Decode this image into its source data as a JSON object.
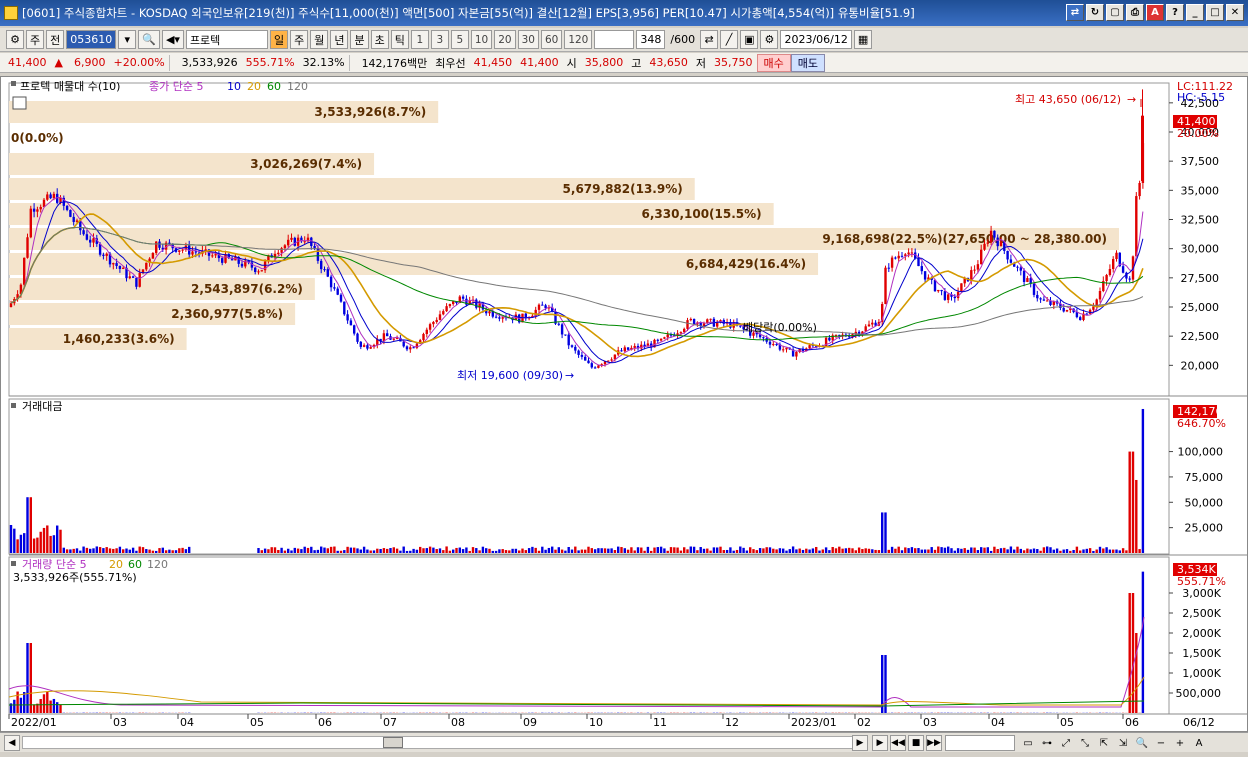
{
  "window": {
    "title": "[0601] 주식종합차트 - KOSDAQ 외국인보유[219(천)] 주식수[11,000(천)] 액면[500] 자본금[55(억)] 결산[12월] EPS[3,956] PER[10.47] 시가총액[4,554(억)] 유통비율[51.9]"
  },
  "toolbar": {
    "market": "주",
    "prev": "전",
    "code": "053610",
    "name": "프로텍",
    "periods": [
      "일",
      "주",
      "월",
      "년",
      "분",
      "초",
      "틱"
    ],
    "active_period": "일",
    "intervals": [
      "1",
      "3",
      "5",
      "10",
      "20",
      "30",
      "60",
      "120"
    ],
    "count": "348",
    "count_total": "/600",
    "date": "2023/06/12"
  },
  "quote": {
    "price": "41,400",
    "arrow": "▲",
    "change": "6,900",
    "change_pct": "+20.00%",
    "volume": "3,533,926",
    "volume_pct": "555.71%",
    "turnover": "32.13%",
    "amount": "142,176백만",
    "best_label": "최우선",
    "best_ask": "41,450",
    "best_bid": "41,400",
    "open_label": "시",
    "open": "35,800",
    "high_label": "고",
    "high": "43,650",
    "low_label": "저",
    "low": "35,750",
    "buy": "매수",
    "sell": "매도"
  },
  "price_panel": {
    "legend_profile": "프로텍 매물대 수(10)",
    "legend_ma": "종가 단순 5",
    "ma_periods": [
      "10",
      "20",
      "60",
      "120"
    ],
    "ma_colors": {
      "5": "#b030c0",
      "10": "#0000cc",
      "20": "#d49a00",
      "60": "#008800",
      "120": "#777777"
    },
    "lc": "LC:111.22",
    "hc": "HC:-5.15",
    "price_tag": "41,400",
    "pct_tag": "20.00%",
    "y_ticks": [
      "42,500",
      "40,000",
      "37,500",
      "35,000",
      "32,500",
      "30,000",
      "27,500",
      "25,000",
      "22,500",
      "20,000"
    ],
    "annot_high": "최고 43,650 (06/12)",
    "annot_low": "최저 19,600 (09/30)",
    "annot_div": "배당락(0.00%)",
    "profile": [
      {
        "label": "3,533,926(8.7%)",
        "value": 8.7
      },
      {
        "label": "0(0.0%)",
        "value": 0
      },
      {
        "label": "3,026,269(7.4%)",
        "value": 7.4
      },
      {
        "label": "5,679,882(13.9%)",
        "value": 13.9
      },
      {
        "label": "6,330,100(15.5%)",
        "value": 15.5
      },
      {
        "label": "9,168,698(22.5%)(27,650.00 ~ 28,380.00)",
        "value": 22.5
      },
      {
        "label": "6,684,429(16.4%)",
        "value": 16.4
      },
      {
        "label": "2,543,897(6.2%)",
        "value": 6.2
      },
      {
        "label": "2,360,977(5.8%)",
        "value": 5.8
      },
      {
        "label": "1,460,233(3.6%)",
        "value": 3.6
      }
    ]
  },
  "amount_panel": {
    "legend": "거래대금",
    "tag": "142,176",
    "pct": "646.70%",
    "y_ticks": [
      "100,000",
      "75,000",
      "50,000",
      "25,000"
    ]
  },
  "volume_panel": {
    "legend": "거래량 단순 5",
    "ma_periods": [
      "20",
      "60",
      "120"
    ],
    "sub": "3,533,926주(555.71%)",
    "tag": "3,534K",
    "pct": "555.71%",
    "y_ticks": [
      "3,000K",
      "2,500K",
      "2,000K",
      "1,500K",
      "1,000K",
      "500,000"
    ]
  },
  "x_axis": [
    "2022/01",
    "03",
    "04",
    "05",
    "06",
    "07",
    "08",
    "09",
    "10",
    "11",
    "12",
    "2023/01",
    "02",
    "03",
    "04",
    "05",
    "06"
  ],
  "x_axis_right": "06/12"
}
